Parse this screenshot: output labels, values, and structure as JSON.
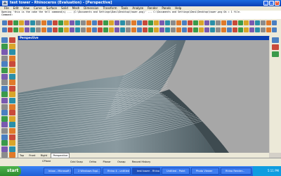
{
  "window": {
    "title": "test tower - Rhinoceros (Evaluation) - [Perspective]"
  },
  "menu": [
    "File",
    "Edit",
    "View",
    "Curve",
    "Surface",
    "Solid",
    "Mesh",
    "Dimension",
    "Transform",
    "Tools",
    "Analyze",
    "Render",
    "Panels",
    "Help"
  ],
  "command_history": [
    "Opening 'this is the cake the tell command(s) ... (C:\\Documents and Settings\\Dani\\Desktop\\tower.png)' ... C:\\Documents and Settings\\Dani\\Desktop\\tower.png  Ok = 1 file.",
    "Command:"
  ],
  "viewport": {
    "title": "Perspective",
    "tabs": [
      "Top",
      "Front",
      "Right",
      "Perspective"
    ],
    "active_tab": "Perspective",
    "background": "#a7a7a7"
  },
  "status": {
    "cplane": "CPlane",
    "cells": [
      "Grid Snap",
      "Ortho",
      "Planar",
      "Osnap",
      "Record History"
    ]
  },
  "taskbar": {
    "start": "start",
    "tasks": [
      "Inbox - Microsoft Out...",
      "2 Windows Expl...",
      "Rhino 4 - untitled",
      "test tower - Rhino...",
      "Untitled - Paint",
      "Photo Viewer",
      "Rhino Render..."
    ],
    "active_task": 3,
    "clock": "5:11 PM"
  },
  "colors": {
    "title_bar": "#0a3fb4",
    "taskbar": "#1f5fd6",
    "start_button": "#3a9a3a"
  }
}
